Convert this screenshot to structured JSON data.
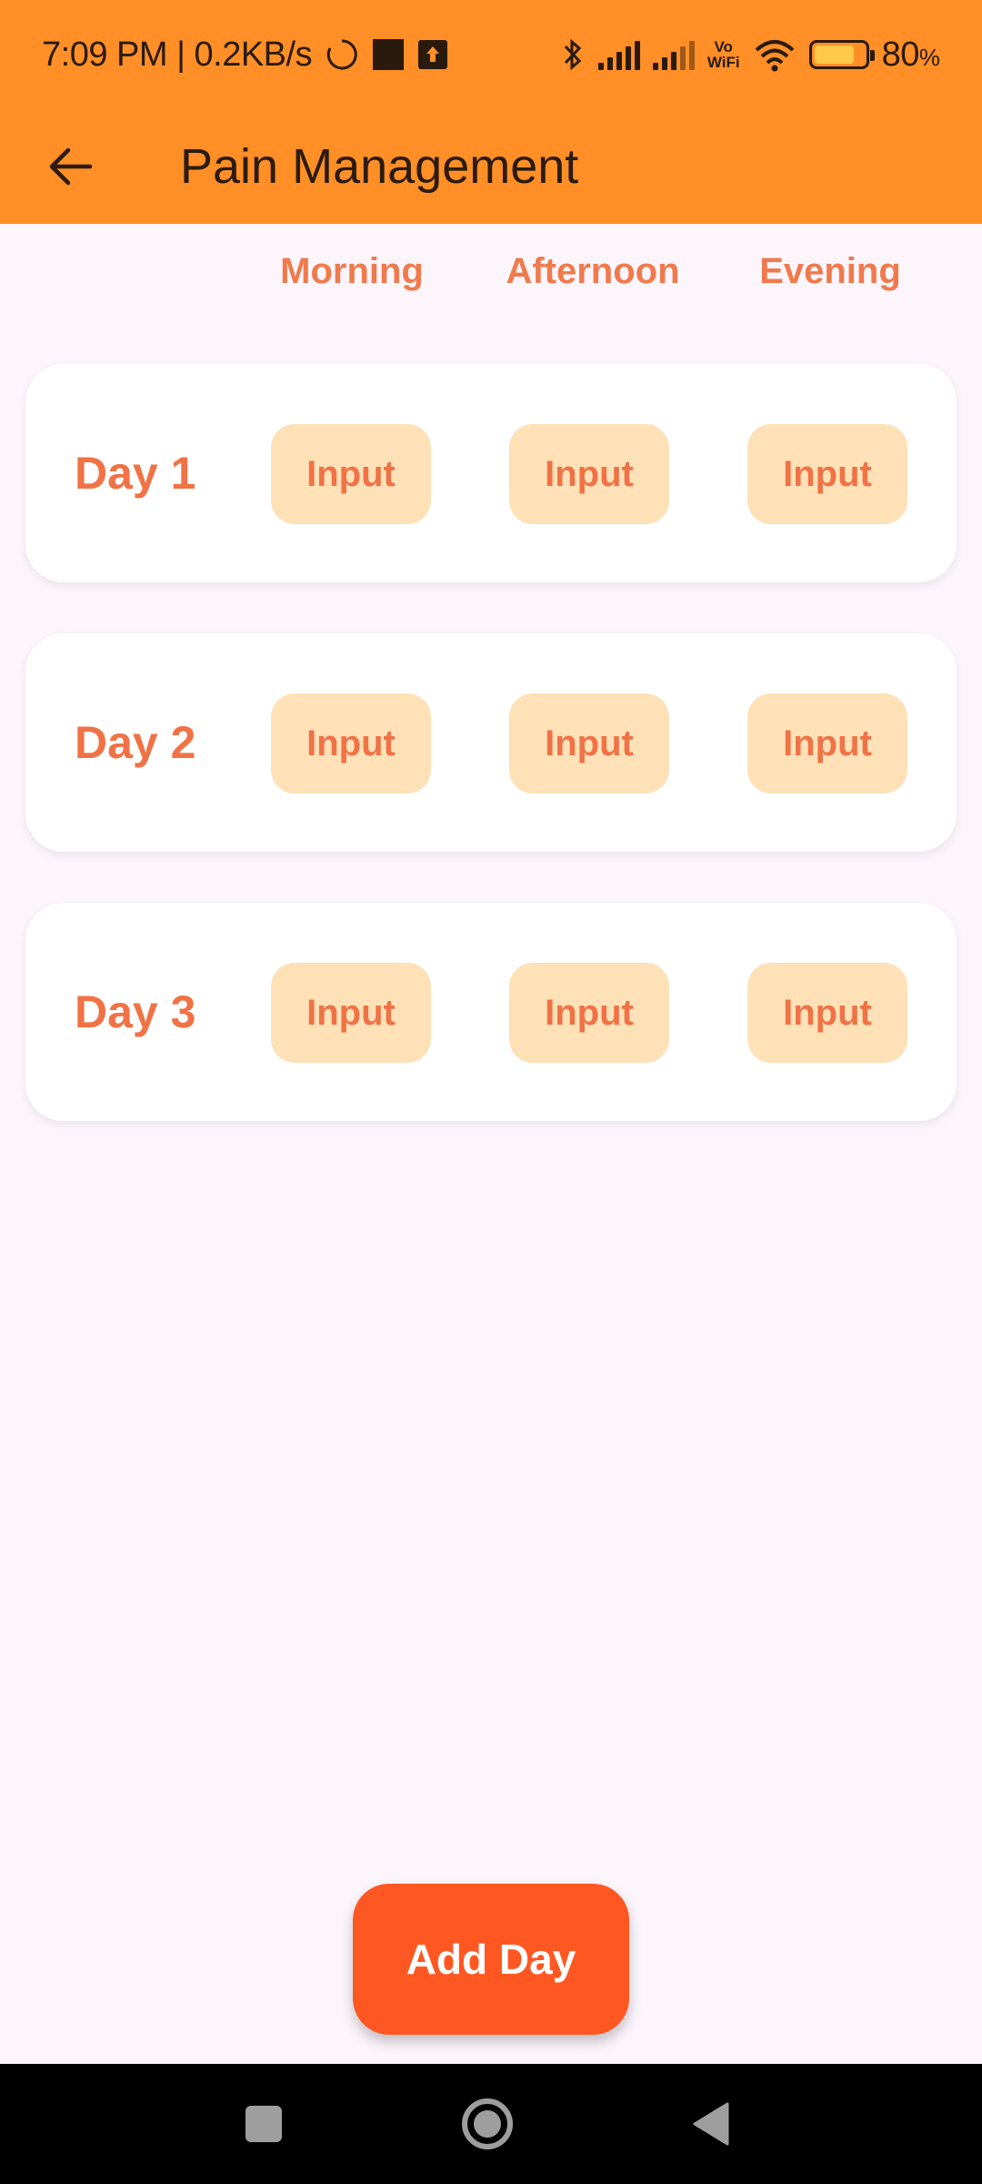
{
  "status_bar": {
    "time_speed": "7:09 PM | 0.2KB/s",
    "vowifi_top": "Vo",
    "vowifi_bottom": "WiFi",
    "battery_level": 0.8,
    "battery_percent": "80",
    "battery_suffix": "%"
  },
  "app_bar": {
    "title": "Pain Management"
  },
  "columns": [
    "Morning",
    "Afternoon",
    "Evening"
  ],
  "days": [
    {
      "label": "Day 1",
      "inputs": [
        "Input",
        "Input",
        "Input"
      ]
    },
    {
      "label": "Day 2",
      "inputs": [
        "Input",
        "Input",
        "Input"
      ]
    },
    {
      "label": "Day 3",
      "inputs": [
        "Input",
        "Input",
        "Input"
      ]
    }
  ],
  "add_button": {
    "label": "Add Day"
  },
  "colors": {
    "app_bar": "#ff8f26",
    "accent_text": "#f07245",
    "input_bg": "#ffe1b8",
    "add_button": "#ff5722",
    "background": "#fcf5fc"
  }
}
